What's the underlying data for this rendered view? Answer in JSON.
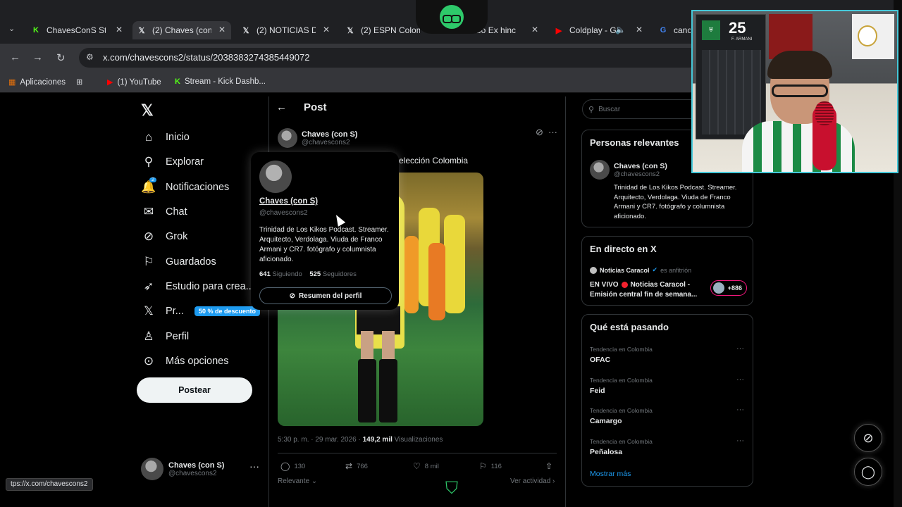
{
  "browser": {
    "tabs": [
      {
        "title": "ChavesConS Stre",
        "icon": "kick-icon"
      },
      {
        "title": "(2) Chaves (con",
        "icon": "x-icon",
        "active": true
      },
      {
        "title": "(2) NOTICIAS DE",
        "icon": "x-icon"
      },
      {
        "title": "(2) ESPN Colom",
        "icon": "x-icon"
      },
      {
        "title": "Gabo Ex hinc",
        "icon": "globe-icon"
      },
      {
        "title": "Coldplay - G",
        "icon": "youtube-icon"
      },
      {
        "title": "canc",
        "icon": "google-icon"
      }
    ],
    "url": "x.com/chavescons2/status/2038383274385449072",
    "bookmarks": [
      {
        "label": "Aplicaciones",
        "icon": "apps-icon"
      },
      {
        "label": "(1) YouTube",
        "icon": "youtube-icon"
      },
      {
        "label": "Stream - Kick Dashb...",
        "icon": "kick-icon"
      }
    ],
    "status_url": "tps://x.com/chavescons2"
  },
  "nav": {
    "items": [
      {
        "label": "Inicio",
        "icon": "home-icon"
      },
      {
        "label": "Explorar",
        "icon": "search-icon"
      },
      {
        "label": "Notificaciones",
        "icon": "bell-icon",
        "badge": "2"
      },
      {
        "label": "Chat",
        "icon": "mail-icon"
      },
      {
        "label": "Grok",
        "icon": "grok-icon"
      },
      {
        "label": "Guardados",
        "icon": "bookmark-icon"
      },
      {
        "label": "Estudio para crea...",
        "icon": "rocket-icon"
      },
      {
        "label": "Pr...",
        "icon": "x-icon"
      },
      {
        "label": "Perfil",
        "icon": "person-icon"
      },
      {
        "label": "Más opciones",
        "icon": "more-circle-icon"
      }
    ],
    "premium_badge": "50 % de descuento",
    "post_button": "Postear",
    "me": {
      "name": "Chaves (con S)",
      "handle": "@chavescons2"
    }
  },
  "post": {
    "header": "Post",
    "author": {
      "name": "Chaves (con S)",
      "handle": "@chavescons2"
    },
    "text": "elección Colombia",
    "timestamp": "5:30 p. m. · 29 mar. 2026 · ",
    "views": "149,2 mil",
    "views_label": "Visualizaciones",
    "actions": {
      "replies": "130",
      "reposts": "766",
      "likes": "8 mil",
      "bookmarks": "116"
    },
    "relevance": "Relevante ⌄",
    "view_activity": "Ver actividad ›"
  },
  "hovercard": {
    "name": "Chaves (con S)",
    "handle": "@chavescons2",
    "bio": "Trinidad de Los Kikos Podcast. Streamer. Arquitecto, Verdolaga. Viuda de Franco Armani y CR7. fotógrafo y columnista aficionado.",
    "following": "641",
    "following_label": "Siguiendo",
    "followers": "525",
    "followers_label": "Seguidores",
    "summary_button": "Resumen del perfil"
  },
  "sidebar": {
    "search_placeholder": "Buscar",
    "relevant": {
      "title": "Personas relevantes",
      "name": "Chaves (con S)",
      "handle": "@chavescons2",
      "bio": "Trinidad de Los Kikos Podcast. Streamer. Arquitecto, Verdolaga. Viuda de Franco Armani y CR7. fotógrafo y columnista aficionado."
    },
    "live": {
      "title": "En directo en X",
      "source": "Noticias Caracol",
      "host_label": "es anfitrión",
      "prefix": "EN VIVO",
      "headline": "Noticias Caracol - Emisión central fin de semana...",
      "count": "+886"
    },
    "trends": {
      "title": "Qué está pasando",
      "items": [
        {
          "context": "Tendencia en Colombia",
          "name": "OFAC"
        },
        {
          "context": "Tendencia en Colombia",
          "name": "Feid"
        },
        {
          "context": "Tendencia en Colombia",
          "name": "Camargo"
        },
        {
          "context": "Tendencia en Colombia",
          "name": "Peñalosa"
        }
      ],
      "show_more": "Mostrar más"
    }
  },
  "webcam": {
    "jersey_number": "25",
    "jersey_name": "F. ARMANI"
  },
  "colors": {
    "accent": "#1d9bf0",
    "brand_green": "#2ec96a",
    "live_red": "#f4212e",
    "webcam_border": "#45c8d9"
  }
}
